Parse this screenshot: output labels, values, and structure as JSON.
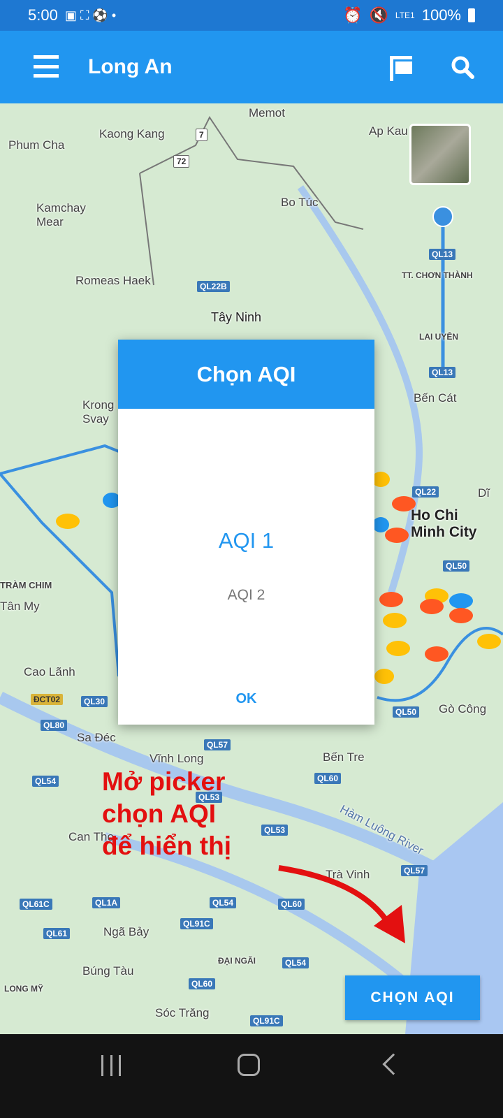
{
  "status": {
    "time": "5:00",
    "battery": "100%",
    "network": "LTE1"
  },
  "appbar": {
    "title": "Long An"
  },
  "map": {
    "labels": [
      "Phum Cha",
      "Kaong Kang",
      "Memot",
      "Ap Kau",
      "Kamchay Mear",
      "Bo Túc",
      "Romeas Haek",
      "Tây Ninh",
      "TT. CHƠN THÀNH",
      "LAI UYÊN",
      "Bến Cát",
      "Krong Svay",
      "Ho Chi Minh City",
      "TRÀM CHIM",
      "Tân My",
      "Cao Lãnh",
      "Gò Công",
      "Sa Đéc",
      "Vĩnh Long",
      "Bến Tre",
      "Can Tho",
      "Hàm Luông River",
      "Trà Vinh",
      "Ngã Bảy",
      "Búng Tàu",
      "ĐẠI NGÃI",
      "LONG MỸ",
      "Sóc Trăng",
      "Dĩ"
    ],
    "routes": [
      "7",
      "72",
      "QL22B",
      "QL13",
      "QL13",
      "QL22",
      "QL50",
      "ĐCT02",
      "QL30",
      "QL80",
      "QL54",
      "QL57",
      "QL53",
      "QL60",
      "QL53",
      "QL57",
      "QL61C",
      "QL1A",
      "QL54",
      "QL60",
      "QL61",
      "QL91C",
      "QL54",
      "QL60",
      "QL91C",
      "QL50"
    ]
  },
  "dialog": {
    "title": "Chọn AQI",
    "options": [
      "AQI 1",
      "AQI 2"
    ],
    "selected": "AQI 1",
    "ok": "OK"
  },
  "annotation": {
    "line1": "Mở picker",
    "line2": "chọn AQI",
    "line3": "để hiển thị"
  },
  "button": {
    "label": "CHỌN AQI"
  }
}
